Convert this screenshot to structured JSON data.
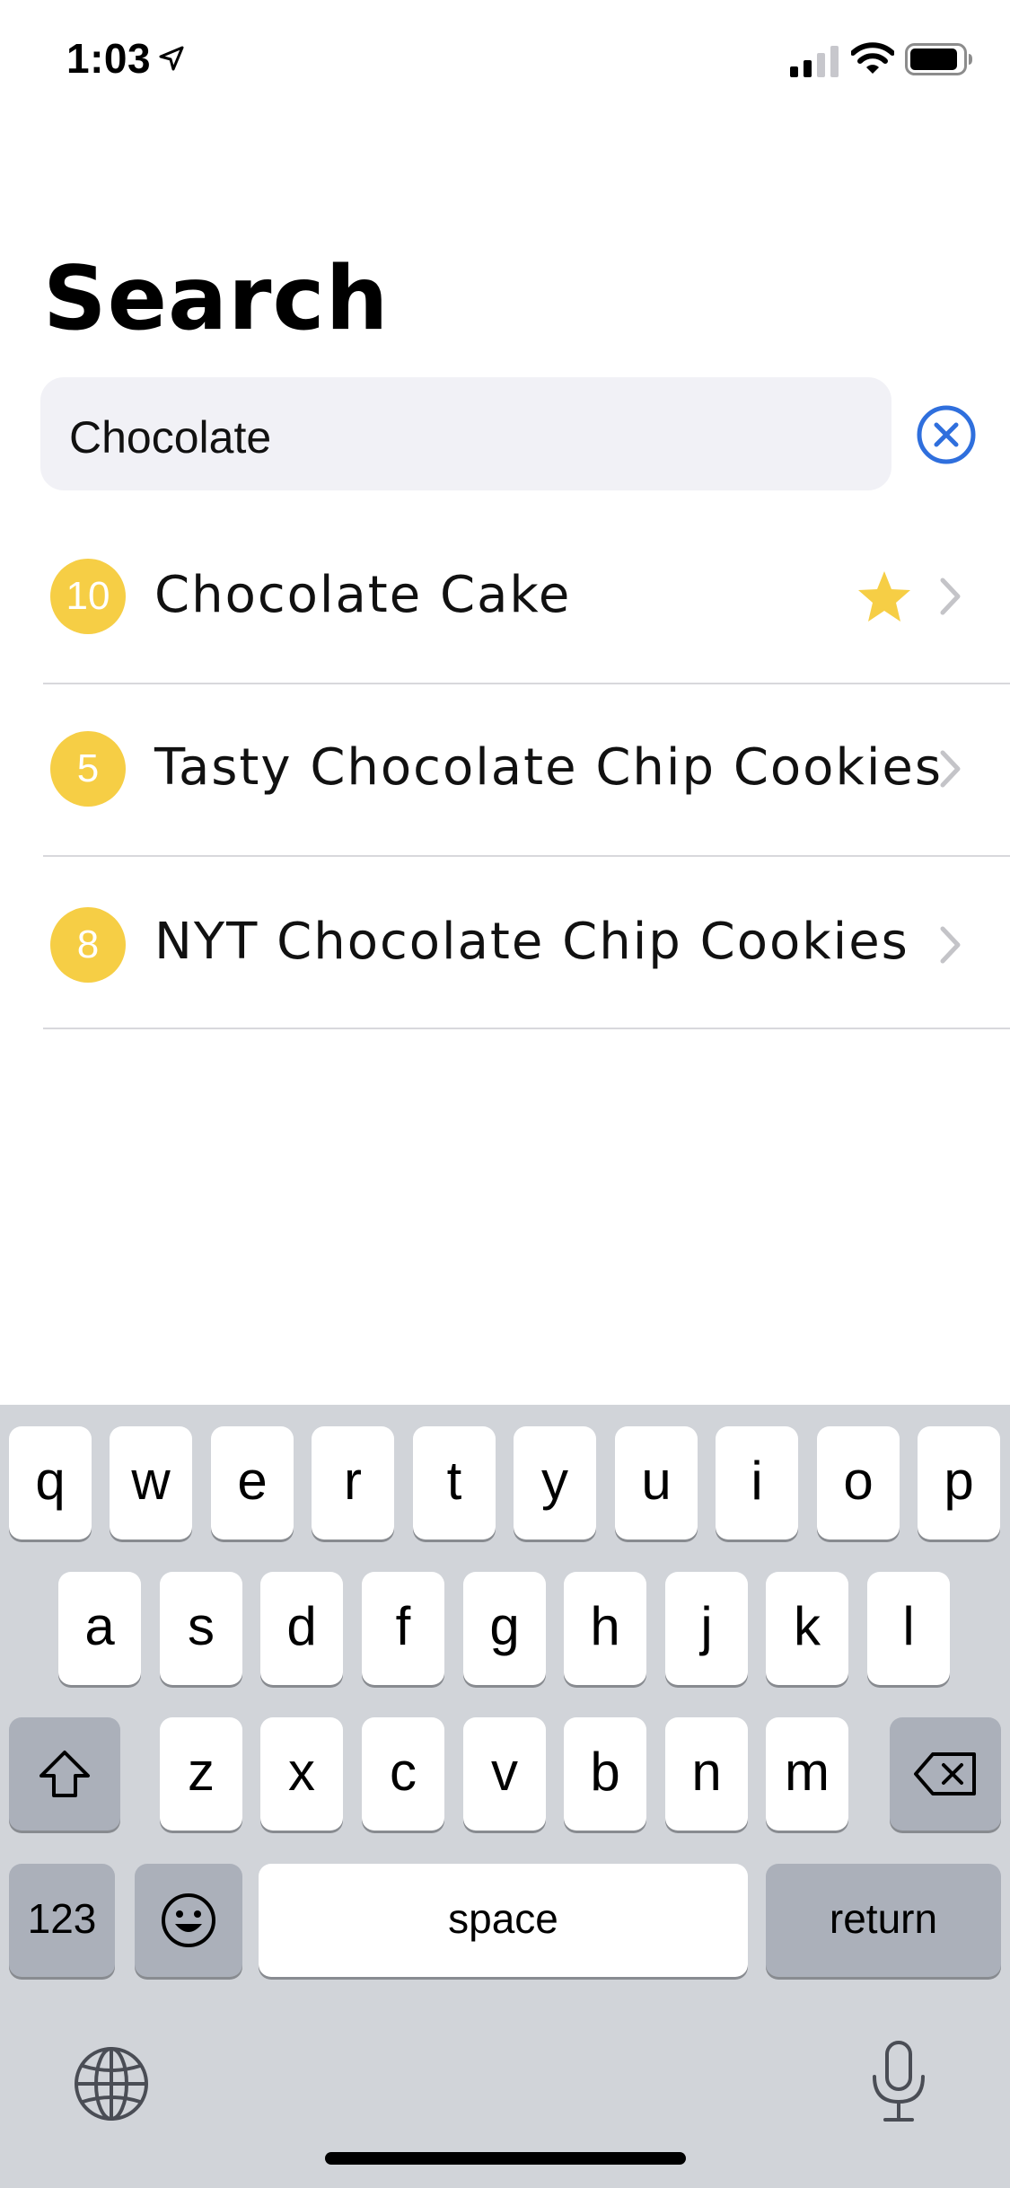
{
  "status_bar": {
    "time": "1:03",
    "icons": [
      "location-arrow-icon",
      "cellular-signal-icon",
      "wifi-icon",
      "battery-icon"
    ]
  },
  "page": {
    "title": "Search"
  },
  "search": {
    "value": "Chocolate",
    "clear_icon": "clear-circle-icon",
    "accent_color": "#2f6fdd"
  },
  "results": [
    {
      "count": "10",
      "title": "Chocolate Cake",
      "favorite": true
    },
    {
      "count": "5",
      "title": "Tasty Chocolate Chip Cookies",
      "favorite": false
    },
    {
      "count": "8",
      "title": "NYT Chocolate Chip Cookies",
      "favorite": false
    }
  ],
  "colors": {
    "badge": "#f6ce45",
    "star": "#f6ce45"
  },
  "keyboard": {
    "row1": [
      "q",
      "w",
      "e",
      "r",
      "t",
      "y",
      "u",
      "i",
      "o",
      "p"
    ],
    "row2": [
      "a",
      "s",
      "d",
      "f",
      "g",
      "h",
      "j",
      "k",
      "l"
    ],
    "row3": [
      "z",
      "x",
      "c",
      "v",
      "b",
      "n",
      "m"
    ],
    "numbers_label": "123",
    "space_label": "space",
    "return_label": "return",
    "icons": [
      "shift-icon",
      "backspace-icon",
      "emoji-icon",
      "globe-icon",
      "microphone-icon"
    ]
  }
}
